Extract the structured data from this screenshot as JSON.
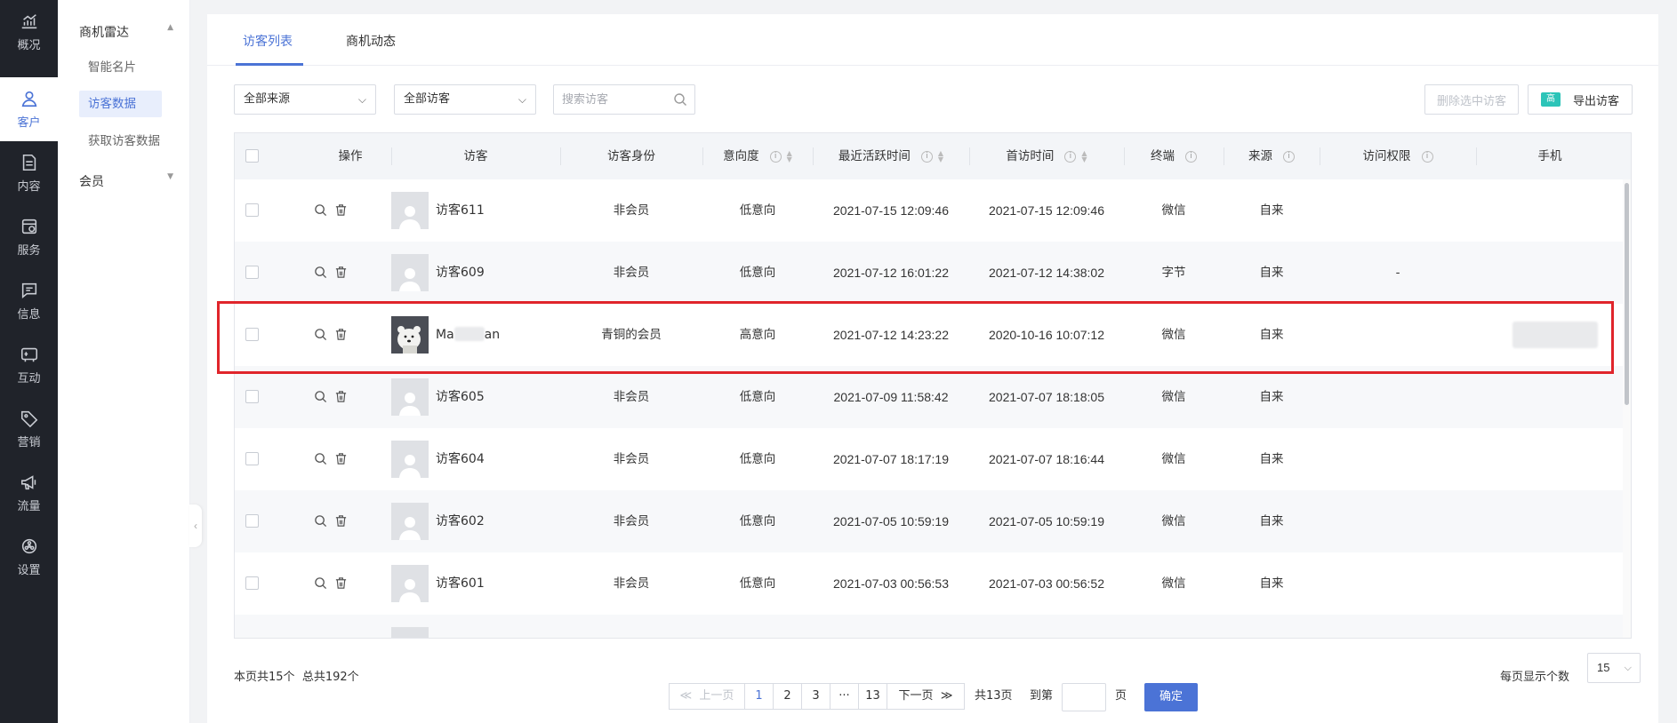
{
  "rail": {
    "items": [
      {
        "label": "概况",
        "icon": "chart-trend-icon"
      },
      {
        "label": "客户",
        "icon": "user-icon"
      },
      {
        "label": "内容",
        "icon": "document-icon"
      },
      {
        "label": "服务",
        "icon": "service-icon"
      },
      {
        "label": "信息",
        "icon": "message-icon"
      },
      {
        "label": "互动",
        "icon": "interaction-icon"
      },
      {
        "label": "营销",
        "icon": "tag-icon"
      },
      {
        "label": "流量",
        "icon": "megaphone-icon"
      },
      {
        "label": "设置",
        "icon": "gear-icon"
      }
    ],
    "active_index": 1,
    "active_color": "#4b73d6"
  },
  "submenu": {
    "group1": "商机雷达",
    "items": [
      "智能名片",
      "访客数据",
      "获取访客数据"
    ],
    "group2": "会员"
  },
  "tabs": [
    "访客列表",
    "商机动态"
  ],
  "filters": {
    "source": "全部来源",
    "visitors": "全部访客",
    "search_placeholder": "搜索访客"
  },
  "buttons": {
    "delete_selected": "删除选中访客",
    "export_badge": "高",
    "export": "导出访客"
  },
  "table": {
    "headers": [
      "操作",
      "访客",
      "访客身份",
      "意向度",
      "最近活跃时间",
      "首访时间",
      "终端",
      "来源",
      "访问权限",
      "手机"
    ],
    "rows": [
      {
        "name": "访客611",
        "identity": "非会员",
        "intent": "低意向",
        "last_active": "2021-07-15 12:09:46",
        "first_visit": "2021-07-15 12:09:46",
        "terminal": "微信",
        "source": "自来",
        "permission": "",
        "phone": ""
      },
      {
        "name": "访客609",
        "identity": "非会员",
        "intent": "低意向",
        "last_active": "2021-07-12 16:01:22",
        "first_visit": "2021-07-12 14:38:02",
        "terminal": "字节",
        "source": "自来",
        "permission": "-",
        "phone": ""
      },
      {
        "name_prefix": "Ma",
        "name_suffix": "an",
        "identity": "青铜的会员",
        "intent": "高意向",
        "last_active": "2021-07-12 14:23:22",
        "first_visit": "2020-10-16 10:07:12",
        "terminal": "微信",
        "source": "自来",
        "permission": "",
        "phone": ""
      },
      {
        "name": "访客605",
        "identity": "非会员",
        "intent": "低意向",
        "last_active": "2021-07-09 11:58:42",
        "first_visit": "2021-07-07 18:18:05",
        "terminal": "微信",
        "source": "自来",
        "permission": "",
        "phone": ""
      },
      {
        "name": "访客604",
        "identity": "非会员",
        "intent": "低意向",
        "last_active": "2021-07-07 18:17:19",
        "first_visit": "2021-07-07 18:16:44",
        "terminal": "微信",
        "source": "自来",
        "permission": "",
        "phone": ""
      },
      {
        "name": "访客602",
        "identity": "非会员",
        "intent": "低意向",
        "last_active": "2021-07-05 10:59:19",
        "first_visit": "2021-07-05 10:59:19",
        "terminal": "微信",
        "source": "自来",
        "permission": "",
        "phone": ""
      },
      {
        "name": "访客601",
        "identity": "非会员",
        "intent": "低意向",
        "last_active": "2021-07-03 00:56:53",
        "first_visit": "2021-07-03 00:56:52",
        "terminal": "微信",
        "source": "自来",
        "permission": "",
        "phone": ""
      }
    ]
  },
  "footer": {
    "page_count": "本页共15个",
    "total": "总共192个",
    "prev": "上一页",
    "pages": [
      "1",
      "2",
      "3",
      "···",
      "13"
    ],
    "current_page": "1",
    "next": "下一页",
    "total_pages": "共13页",
    "goto": "到第",
    "page_unit": "页",
    "confirm": "确定",
    "per_page_label": "每页显示个数",
    "per_page": "15"
  },
  "colors": {
    "primary": "#4b73d6",
    "highlight": "#e0252b",
    "rail_bg": "#20232a"
  }
}
